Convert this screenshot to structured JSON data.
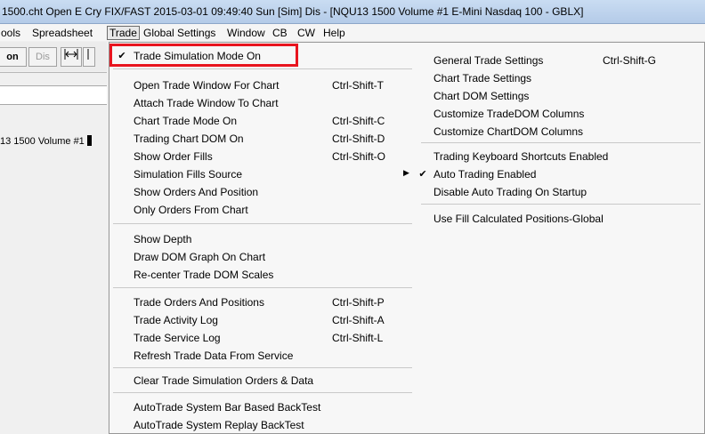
{
  "window": {
    "title": "1500.cht  Open E Cry FIX/FAST 2015-03-01  09:49:40 Sun [Sim]  Dis - [NQU13  1500 Volume  #1  E-Mini Nasdaq 100 - GBLX]"
  },
  "menubar": {
    "items": [
      "ools",
      "Spreadsheet",
      "Trade",
      "Global Settings",
      "Window",
      "CB",
      "CW",
      "Help"
    ]
  },
  "toolbar": {
    "buttons": [
      "on",
      "Dis"
    ]
  },
  "chart": {
    "label": "13  1500 Volume  #1"
  },
  "trade_menu": {
    "items": [
      {
        "label": "Trade Simulation Mode On",
        "shortcut": "",
        "checked": true
      },
      {
        "label": "Open Trade Window For Chart",
        "shortcut": "Ctrl-Shift-T"
      },
      {
        "label": "Attach Trade Window To Chart",
        "shortcut": ""
      },
      {
        "label": "Chart Trade Mode On",
        "shortcut": "Ctrl-Shift-C"
      },
      {
        "label": "Trading Chart DOM On",
        "shortcut": "Ctrl-Shift-D"
      },
      {
        "label": "Show Order Fills",
        "shortcut": "Ctrl-Shift-O"
      },
      {
        "label": "Simulation Fills Source",
        "shortcut": "",
        "submenu": true
      },
      {
        "label": "Show Orders And Position",
        "shortcut": ""
      },
      {
        "label": "Only Orders From Chart",
        "shortcut": ""
      },
      {
        "label": "Show Depth",
        "shortcut": ""
      },
      {
        "label": "Draw DOM Graph On Chart",
        "shortcut": ""
      },
      {
        "label": "Re-center Trade DOM Scales",
        "shortcut": ""
      },
      {
        "label": "Trade Orders And Positions",
        "shortcut": "Ctrl-Shift-P"
      },
      {
        "label": "Trade Activity Log",
        "shortcut": "Ctrl-Shift-A"
      },
      {
        "label": "Trade Service Log",
        "shortcut": "Ctrl-Shift-L"
      },
      {
        "label": "Refresh Trade Data From Service",
        "shortcut": ""
      },
      {
        "label": "Clear Trade Simulation Orders & Data",
        "shortcut": ""
      },
      {
        "label": "AutoTrade System Bar Based BackTest",
        "shortcut": ""
      },
      {
        "label": "AutoTrade System Replay BackTest",
        "shortcut": ""
      }
    ],
    "right_items": [
      {
        "label": "General Trade Settings",
        "shortcut": "Ctrl-Shift-G"
      },
      {
        "label": "Chart Trade Settings",
        "shortcut": ""
      },
      {
        "label": "Chart DOM Settings",
        "shortcut": ""
      },
      {
        "label": "Customize TradeDOM Columns",
        "shortcut": ""
      },
      {
        "label": "Customize ChartDOM Columns",
        "shortcut": ""
      },
      {
        "label": "Trading Keyboard Shortcuts Enabled",
        "shortcut": ""
      },
      {
        "label": "Auto Trading Enabled",
        "shortcut": "",
        "checked": true
      },
      {
        "label": "Disable Auto Trading On Startup",
        "shortcut": ""
      },
      {
        "label": "Use Fill Calculated Positions-Global",
        "shortcut": ""
      }
    ]
  },
  "colors": {
    "highlight_box": "#e8141e"
  }
}
